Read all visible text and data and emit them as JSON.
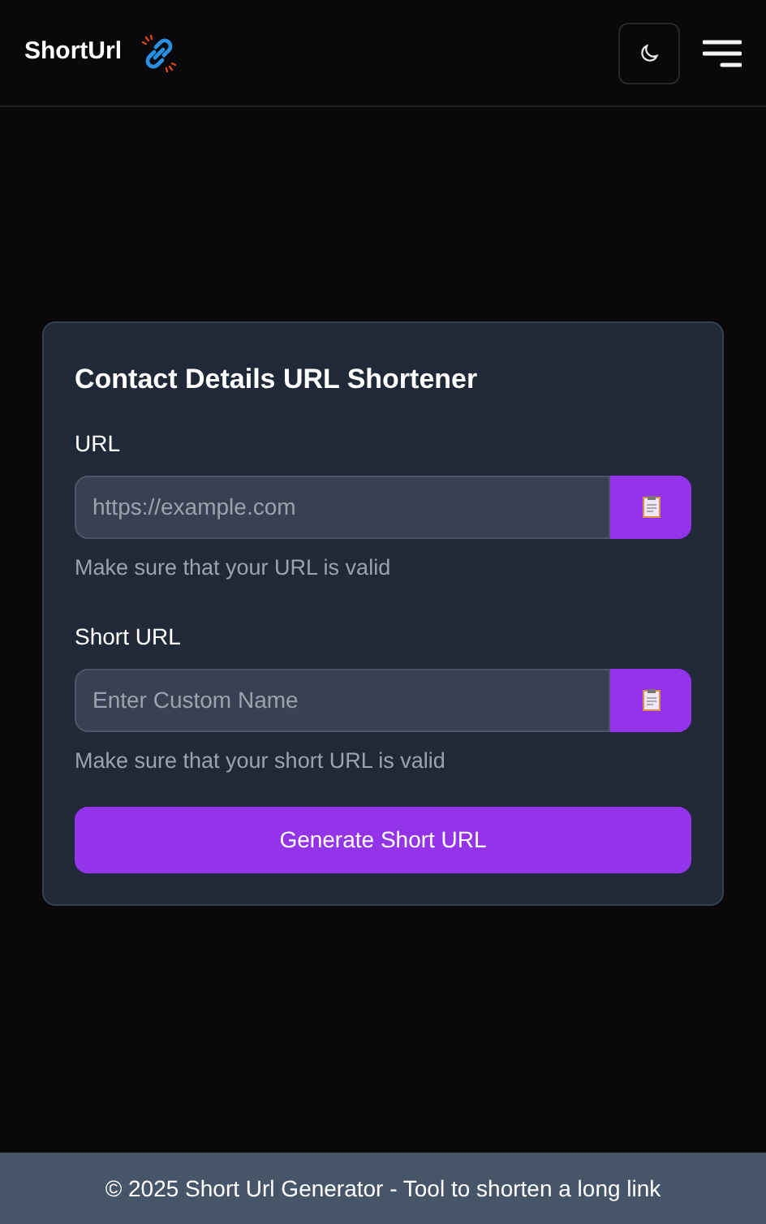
{
  "header": {
    "brand": "ShortUrl"
  },
  "card": {
    "title": "Contact Details URL Shortener",
    "fields": [
      {
        "label": "URL",
        "placeholder": "https://example.com",
        "hint": "Make sure that your URL is valid"
      },
      {
        "label": "Short URL",
        "placeholder": "Enter Custom Name",
        "hint": "Make sure that your short URL is valid"
      }
    ],
    "submit": "Generate Short URL"
  },
  "footer": "© 2025 Short Url Generator - Tool to shorten a long link"
}
